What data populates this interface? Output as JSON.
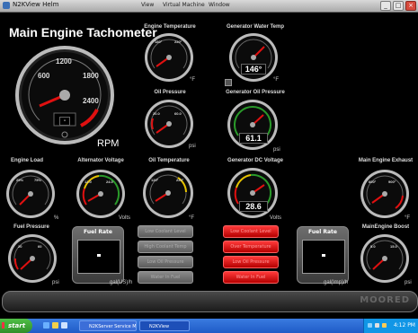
{
  "window": {
    "title": "N2KView Helm",
    "menus": [
      "View",
      "Virtual Machine",
      "Window"
    ],
    "buttons": [
      "_",
      "□",
      "×"
    ]
  },
  "tachometer": {
    "title": "Main Engine Tachometer",
    "unit": "RPM",
    "ticks": [
      "600",
      "1200",
      "1800",
      "2400"
    ],
    "value_display": "-"
  },
  "gauges": {
    "engine_temp": {
      "title": "Engine Temperature",
      "ticks": [
        "180°",
        "190°",
        "200°",
        "210°",
        "220°",
        "230°"
      ],
      "unit": "°F",
      "reading": ""
    },
    "gen_water_temp": {
      "title": "Generator Water Temp",
      "ticks": [
        "40°",
        "80°",
        "100°",
        "120°",
        "160°"
      ],
      "unit": "°F",
      "reading": "146°"
    },
    "oil_pressure": {
      "title": "Oil Pressure",
      "ticks": [
        "20.0",
        "40.0",
        "60.0",
        "80.0"
      ],
      "unit": "psi",
      "reading": ""
    },
    "gen_oil_pressure": {
      "title": "Generator Oil Pressure",
      "ticks": [
        "20.0",
        "40.0",
        "60.0",
        "80.0"
      ],
      "unit": "psi",
      "reading": "61.1"
    },
    "engine_load": {
      "title": "Engine Load",
      "ticks": [
        "25%",
        "50%",
        "75%",
        "100%"
      ],
      "unit": "%",
      "reading": ""
    },
    "alternator_voltage": {
      "title": "Alternator Voltage",
      "ticks": [
        "12.0",
        "18.0",
        "24.0",
        "32.0"
      ],
      "unit": "Volts",
      "reading": ""
    },
    "oil_temperature": {
      "title": "Oil Temperature",
      "ticks": [
        "120°",
        "170°",
        "220°",
        "270°"
      ],
      "unit": "°F",
      "reading": ""
    },
    "gen_dc_voltage": {
      "title": "Generator DC Voltage",
      "ticks": [
        "12.0",
        "18.0",
        "24.0",
        "32.0"
      ],
      "unit": "Volts",
      "reading": "28.6"
    },
    "main_exhaust": {
      "title": "Main Engine Exhaust",
      "ticks": [
        "600°",
        "750°",
        "900°",
        "1200°"
      ],
      "unit": "°F",
      "reading": ""
    },
    "fuel_pressure": {
      "title": "Fuel Pressure",
      "ticks": [
        "20",
        "40",
        "60",
        "80"
      ],
      "unit": "psi",
      "reading": ""
    },
    "main_boost": {
      "title": "MainEngine Boost",
      "ticks": [
        "5.0",
        "10.0",
        "15.0",
        "20.0"
      ],
      "unit": "psi",
      "reading": ""
    }
  },
  "fuel_rate_left": {
    "title": "Fuel Rate",
    "unit": "gal(US)/h",
    "value": "-"
  },
  "fuel_rate_right": {
    "title": "Fuel Rate",
    "unit": "gal(Imp)/h",
    "value": "-"
  },
  "alarms_left": [
    "Low Coolant Level",
    "High Coolant Temp",
    "Low Oil Pressure",
    "Water In Fuel"
  ],
  "alarms_right": [
    "Low Coolant Level",
    "Over Temperature",
    "Low Oil Pressure",
    "Water In Fuel"
  ],
  "status_bar": {
    "label": "MOORED"
  },
  "taskbar": {
    "start_label": "start",
    "windows": [
      "N2KServer Service M...",
      "N2KView"
    ],
    "clock": "4:12 PM"
  },
  "colors": {
    "accent_red": "#e01010",
    "gauge_face": "#111111",
    "taskbar_blue": "#245edb"
  }
}
